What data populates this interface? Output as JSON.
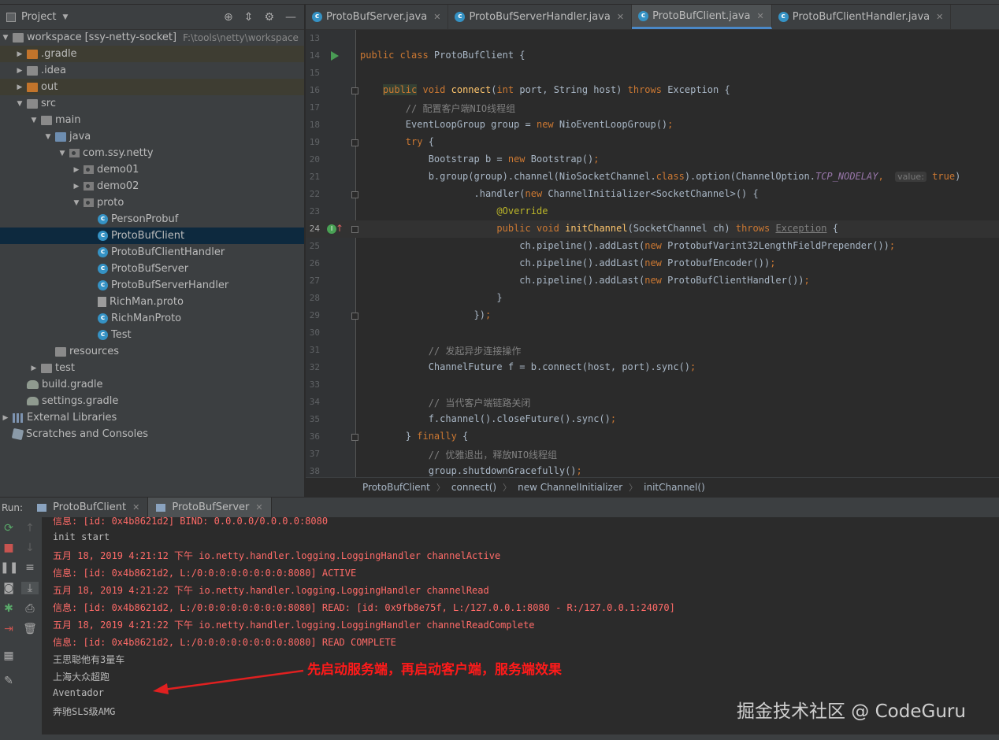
{
  "project": {
    "title": "Project",
    "tree": [
      {
        "label": "workspace",
        "extra": "[ssy-netty-socket]",
        "path": "F:\\tools\\netty\\workspace",
        "depth": 0,
        "arrow": "down",
        "icon": "folder"
      },
      {
        "label": ".gradle",
        "depth": 1,
        "arrow": "right",
        "icon": "folder-orange",
        "hl": true
      },
      {
        "label": ".idea",
        "depth": 1,
        "arrow": "right",
        "icon": "folder"
      },
      {
        "label": "out",
        "depth": 1,
        "arrow": "right",
        "icon": "folder-orange",
        "hl": true
      },
      {
        "label": "src",
        "depth": 1,
        "arrow": "down",
        "icon": "folder"
      },
      {
        "label": "main",
        "depth": 2,
        "arrow": "down",
        "icon": "folder"
      },
      {
        "label": "java",
        "depth": 3,
        "arrow": "down",
        "icon": "folder-src"
      },
      {
        "label": "com.ssy.netty",
        "depth": 4,
        "arrow": "down",
        "icon": "package"
      },
      {
        "label": "demo01",
        "depth": 5,
        "arrow": "right",
        "icon": "package"
      },
      {
        "label": "demo02",
        "depth": 5,
        "arrow": "right",
        "icon": "package"
      },
      {
        "label": "proto",
        "depth": 5,
        "arrow": "down",
        "icon": "package"
      },
      {
        "label": "PersonProbuf",
        "depth": 6,
        "icon": "class"
      },
      {
        "label": "ProtoBufClient",
        "depth": 6,
        "icon": "class",
        "selected": true
      },
      {
        "label": "ProtoBufClientHandler",
        "depth": 6,
        "icon": "class"
      },
      {
        "label": "ProtoBufServer",
        "depth": 6,
        "icon": "class"
      },
      {
        "label": "ProtoBufServerHandler",
        "depth": 6,
        "icon": "class"
      },
      {
        "label": "RichMan.proto",
        "depth": 6,
        "icon": "file"
      },
      {
        "label": "RichManProto",
        "depth": 6,
        "icon": "class"
      },
      {
        "label": "Test",
        "depth": 6,
        "icon": "class"
      },
      {
        "label": "resources",
        "depth": 3,
        "icon": "folder"
      },
      {
        "label": "test",
        "depth": 2,
        "arrow": "right",
        "icon": "folder"
      },
      {
        "label": "build.gradle",
        "depth": 1,
        "icon": "gradle"
      },
      {
        "label": "settings.gradle",
        "depth": 1,
        "icon": "gradle"
      },
      {
        "label": "External Libraries",
        "depth": 0,
        "arrow": "right",
        "icon": "library"
      },
      {
        "label": "Scratches and Consoles",
        "depth": 0,
        "icon": "scratch"
      }
    ]
  },
  "editor": {
    "tabs": [
      {
        "label": "ProtoBufServer.java",
        "active": false
      },
      {
        "label": "ProtoBufServerHandler.java",
        "active": false
      },
      {
        "label": "ProtoBufClient.java",
        "active": true
      },
      {
        "label": "ProtoBufClientHandler.java",
        "active": false
      }
    ],
    "lines": [
      {
        "n": "13",
        "code": []
      },
      {
        "n": "14",
        "run": true,
        "code": [
          [
            "kw",
            "public class "
          ],
          [
            "p",
            "ProtoBufClient {"
          ]
        ]
      },
      {
        "n": "15",
        "code": []
      },
      {
        "n": "16",
        "fold": true,
        "code": [
          [
            "p",
            "    "
          ],
          [
            "kwhl",
            "public"
          ],
          [
            "kw",
            " void "
          ],
          [
            "fn",
            "connect"
          ],
          [
            "p",
            "("
          ],
          [
            "kw",
            "int "
          ],
          [
            "p",
            "port, String host) "
          ],
          [
            "kw",
            "throws "
          ],
          [
            "p",
            "Exception {"
          ]
        ]
      },
      {
        "n": "17",
        "code": [
          [
            "p",
            "        "
          ],
          [
            "cm",
            "// 配置客户端NIO线程组"
          ]
        ]
      },
      {
        "n": "18",
        "code": [
          [
            "p",
            "        EventLoopGroup group = "
          ],
          [
            "kw",
            "new "
          ],
          [
            "p",
            "NioEventLoopGroup()"
          ],
          [
            "kw",
            ";"
          ]
        ]
      },
      {
        "n": "19",
        "fold": true,
        "code": [
          [
            "p",
            "        "
          ],
          [
            "kw",
            "try "
          ],
          [
            "p",
            "{"
          ]
        ]
      },
      {
        "n": "20",
        "code": [
          [
            "p",
            "            Bootstrap b = "
          ],
          [
            "kw",
            "new "
          ],
          [
            "p",
            "Bootstrap()"
          ],
          [
            "kw",
            ";"
          ]
        ]
      },
      {
        "n": "21",
        "code": [
          [
            "p",
            "            b.group(group).channel(NioSocketChannel."
          ],
          [
            "kw",
            "class"
          ],
          [
            "p",
            ").option(ChannelOption."
          ],
          [
            "cst",
            "TCP_NODELAY"
          ],
          [
            "kw",
            ","
          ],
          [
            "p",
            "  "
          ],
          [
            "hint",
            "value:"
          ],
          [
            "p",
            " "
          ],
          [
            "kw",
            "true"
          ],
          [
            "p",
            ")"
          ]
        ]
      },
      {
        "n": "22",
        "fold": true,
        "code": [
          [
            "p",
            "                    .handler("
          ],
          [
            "kw",
            "new "
          ],
          [
            "p",
            "ChannelInitializer<SocketChannel>() {"
          ]
        ]
      },
      {
        "n": "23",
        "code": [
          [
            "p",
            "                        "
          ],
          [
            "an",
            "@Override"
          ]
        ]
      },
      {
        "n": "24",
        "impl": true,
        "current": true,
        "fold": true,
        "code": [
          [
            "p",
            "                        "
          ],
          [
            "kw",
            "public void "
          ],
          [
            "fn",
            "initChannel"
          ],
          [
            "p",
            "(SocketChannel ch) "
          ],
          [
            "kw",
            "throws "
          ],
          [
            "wavy",
            "Exception"
          ],
          [
            "p",
            " {"
          ]
        ]
      },
      {
        "n": "25",
        "code": [
          [
            "p",
            "                            ch.pipeline().addLast("
          ],
          [
            "kw",
            "new "
          ],
          [
            "p",
            "ProtobufVarint32LengthFieldPrepender())"
          ],
          [
            "kw",
            ";"
          ]
        ]
      },
      {
        "n": "26",
        "code": [
          [
            "p",
            "                            ch.pipeline().addLast("
          ],
          [
            "kw",
            "new "
          ],
          [
            "p",
            "ProtobufEncoder())"
          ],
          [
            "kw",
            ";"
          ]
        ]
      },
      {
        "n": "27",
        "code": [
          [
            "p",
            "                            ch.pipeline().addLast("
          ],
          [
            "kw",
            "new "
          ],
          [
            "p",
            "ProtoBufClientHandler())"
          ],
          [
            "kw",
            ";"
          ]
        ]
      },
      {
        "n": "28",
        "code": [
          [
            "p",
            "                        }"
          ]
        ]
      },
      {
        "n": "29",
        "fold": true,
        "code": [
          [
            "p",
            "                    })"
          ],
          [
            "kw",
            ";"
          ]
        ]
      },
      {
        "n": "30",
        "code": []
      },
      {
        "n": "31",
        "code": [
          [
            "p",
            "            "
          ],
          [
            "cm",
            "// 发起异步连接操作"
          ]
        ]
      },
      {
        "n": "32",
        "code": [
          [
            "p",
            "            ChannelFuture f = b.connect(host, port).sync()"
          ],
          [
            "kw",
            ";"
          ]
        ]
      },
      {
        "n": "33",
        "code": []
      },
      {
        "n": "34",
        "code": [
          [
            "p",
            "            "
          ],
          [
            "cm",
            "// 当代客户端链路关闭"
          ]
        ]
      },
      {
        "n": "35",
        "code": [
          [
            "p",
            "            f.channel().closeFuture().sync()"
          ],
          [
            "kw",
            ";"
          ]
        ]
      },
      {
        "n": "36",
        "fold": true,
        "code": [
          [
            "p",
            "        } "
          ],
          [
            "kw",
            "finally "
          ],
          [
            "p",
            "{"
          ]
        ]
      },
      {
        "n": "37",
        "code": [
          [
            "p",
            "            "
          ],
          [
            "cm",
            "// 优雅退出，释放NIO线程组"
          ]
        ]
      },
      {
        "n": "38",
        "code": [
          [
            "p",
            "            group.shutdownGracefully()"
          ],
          [
            "kw",
            ";"
          ]
        ]
      }
    ],
    "breadcrumb": [
      "ProtoBufClient",
      "connect()",
      "new ChannelInitializer",
      "initChannel()"
    ]
  },
  "run": {
    "label": "Run:",
    "tabs": [
      {
        "label": "ProtoBufClient",
        "active": false
      },
      {
        "label": "ProtoBufServer",
        "active": true
      }
    ],
    "console": [
      {
        "text": "信息: [id: 0x4b8621d2] BIND: 0.0.0.0/0.0.0.0:8080",
        "color": "red"
      },
      {
        "text": "init start",
        "color": "white"
      },
      {
        "text": "五月 18, 2019 4:21:12 下午 io.netty.handler.logging.LoggingHandler channelActive",
        "color": "red"
      },
      {
        "text": "信息: [id: 0x4b8621d2, L:/0:0:0:0:0:0:0:0:8080] ACTIVE",
        "color": "red"
      },
      {
        "text": "五月 18, 2019 4:21:22 下午 io.netty.handler.logging.LoggingHandler channelRead",
        "color": "red"
      },
      {
        "text": "信息: [id: 0x4b8621d2, L:/0:0:0:0:0:0:0:0:8080] READ: [id: 0x9fb8e75f, L:/127.0.0.1:8080 - R:/127.0.0.1:24070]",
        "color": "red"
      },
      {
        "text": "五月 18, 2019 4:21:22 下午 io.netty.handler.logging.LoggingHandler channelReadComplete",
        "color": "red"
      },
      {
        "text": "信息: [id: 0x4b8621d2, L:/0:0:0:0:0:0:0:0:8080] READ COMPLETE",
        "color": "red"
      },
      {
        "text": "王思聪他有3量车",
        "color": "white"
      },
      {
        "text": "上海大众超跑",
        "color": "white"
      },
      {
        "text": "Aventador",
        "color": "white"
      },
      {
        "text": "奔驰SLS级AMG",
        "color": "white"
      }
    ]
  },
  "annotation": {
    "text": "先启动服务端，再启动客户端，服务端效果",
    "color": "#ff1a1a"
  },
  "watermark": "掘金技术社区 @ CodeGuru",
  "colors": {
    "background": "#2b2b2b",
    "panel": "#3c3f41",
    "selection": "#0d293e",
    "keyword": "#cc7832",
    "method": "#ffc66d",
    "console_error": "#ff6b68"
  }
}
